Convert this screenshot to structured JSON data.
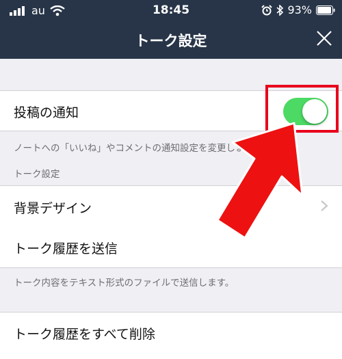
{
  "status_bar": {
    "carrier": "au",
    "time": "18:45",
    "battery": "93%"
  },
  "nav": {
    "title": "トーク設定"
  },
  "settings": {
    "post_notify_label": "投稿の通知",
    "post_notify_enabled": true,
    "post_notify_note": "ノートへの「いいね」やコメントの通知設定を変更します。",
    "section_header": "トーク設定",
    "background_label": "背景デザイン",
    "send_history_label": "トーク履歴を送信",
    "send_history_note": "トーク内容をテキスト形式のファイルで送信します。",
    "delete_history_label": "トーク履歴をすべて削除"
  },
  "colors": {
    "header": "#283548",
    "toggle_on": "#4cd964",
    "highlight": "#e8001c"
  }
}
